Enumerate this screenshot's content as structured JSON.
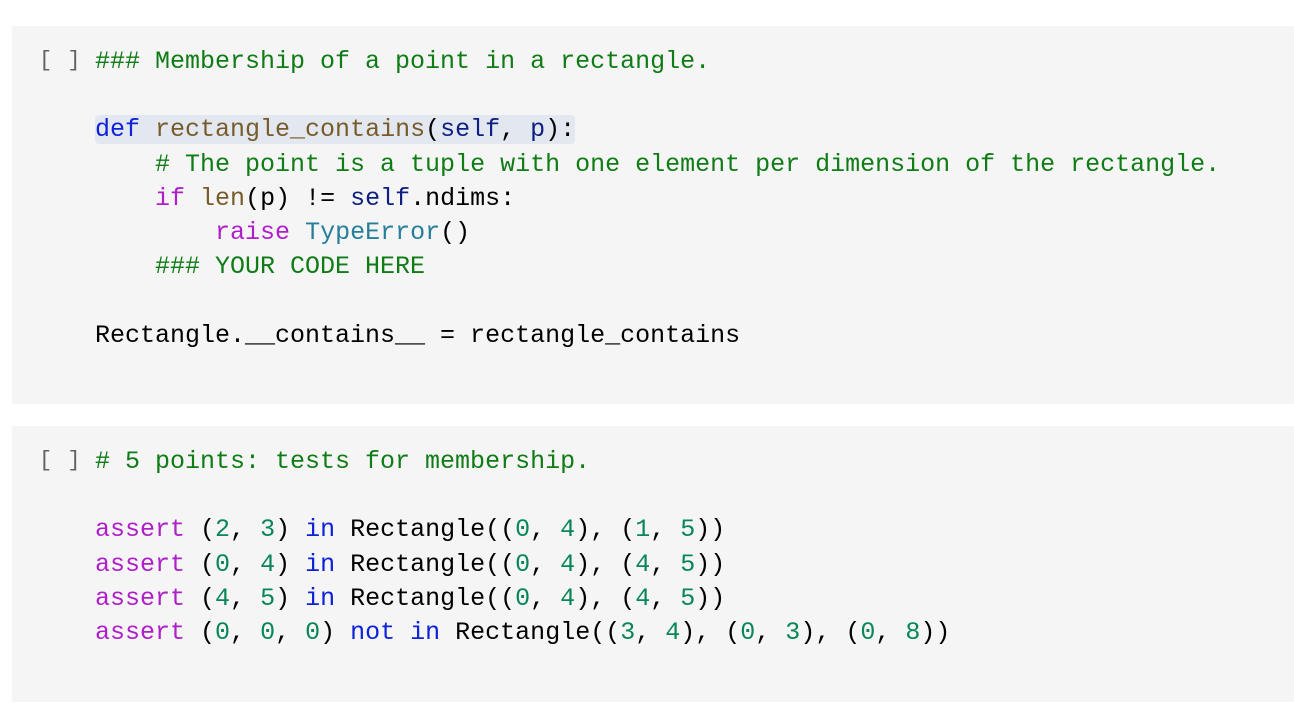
{
  "cells": [
    {
      "prompt": "[ ]",
      "lines": [
        [
          {
            "t": "### Membership of a point in a rectangle.",
            "c": "comment"
          }
        ],
        [],
        [
          {
            "t": "def",
            "c": "kw",
            "hl": true
          },
          {
            "t": " ",
            "c": "plain",
            "hl": true
          },
          {
            "t": "rectangle_contains",
            "c": "fn",
            "hl": true
          },
          {
            "t": "(",
            "c": "plain",
            "hl": true
          },
          {
            "t": "self",
            "c": "var",
            "hl": true
          },
          {
            "t": ", ",
            "c": "plain",
            "hl": true
          },
          {
            "t": "p",
            "c": "var",
            "hl": true
          },
          {
            "t": "):",
            "c": "plain",
            "hl": true
          }
        ],
        [
          {
            "t": "    ",
            "c": "plain"
          },
          {
            "t": "# The point is a tuple with one element per dimension of the rectangle.",
            "c": "comment"
          }
        ],
        [
          {
            "t": "    ",
            "c": "plain"
          },
          {
            "t": "if",
            "c": "ctrl"
          },
          {
            "t": " ",
            "c": "plain"
          },
          {
            "t": "len",
            "c": "fn"
          },
          {
            "t": "(p) != ",
            "c": "plain"
          },
          {
            "t": "self",
            "c": "var"
          },
          {
            "t": ".ndims:",
            "c": "plain"
          }
        ],
        [
          {
            "t": "        ",
            "c": "plain"
          },
          {
            "t": "raise",
            "c": "ctrl"
          },
          {
            "t": " ",
            "c": "plain"
          },
          {
            "t": "TypeError",
            "c": "cls"
          },
          {
            "t": "()",
            "c": "plain"
          }
        ],
        [
          {
            "t": "    ",
            "c": "plain"
          },
          {
            "t": "### YOUR CODE HERE",
            "c": "comment"
          }
        ],
        [],
        [
          {
            "t": "Rectangle.__contains__ = rectangle_contains",
            "c": "plain"
          }
        ]
      ]
    },
    {
      "prompt": "[ ]",
      "lines": [
        [
          {
            "t": "# 5 points: tests for membership.",
            "c": "comment"
          }
        ],
        [],
        [
          {
            "t": "assert",
            "c": "ctrl"
          },
          {
            "t": " (",
            "c": "plain"
          },
          {
            "t": "2",
            "c": "num"
          },
          {
            "t": ", ",
            "c": "plain"
          },
          {
            "t": "3",
            "c": "num"
          },
          {
            "t": ") ",
            "c": "plain"
          },
          {
            "t": "in",
            "c": "kw"
          },
          {
            "t": " Rectangle((",
            "c": "plain"
          },
          {
            "t": "0",
            "c": "num"
          },
          {
            "t": ", ",
            "c": "plain"
          },
          {
            "t": "4",
            "c": "num"
          },
          {
            "t": "), (",
            "c": "plain"
          },
          {
            "t": "1",
            "c": "num"
          },
          {
            "t": ", ",
            "c": "plain"
          },
          {
            "t": "5",
            "c": "num"
          },
          {
            "t": "))",
            "c": "plain"
          }
        ],
        [
          {
            "t": "assert",
            "c": "ctrl"
          },
          {
            "t": " (",
            "c": "plain"
          },
          {
            "t": "0",
            "c": "num"
          },
          {
            "t": ", ",
            "c": "plain"
          },
          {
            "t": "4",
            "c": "num"
          },
          {
            "t": ") ",
            "c": "plain"
          },
          {
            "t": "in",
            "c": "kw"
          },
          {
            "t": " Rectangle((",
            "c": "plain"
          },
          {
            "t": "0",
            "c": "num"
          },
          {
            "t": ", ",
            "c": "plain"
          },
          {
            "t": "4",
            "c": "num"
          },
          {
            "t": "), (",
            "c": "plain"
          },
          {
            "t": "4",
            "c": "num"
          },
          {
            "t": ", ",
            "c": "plain"
          },
          {
            "t": "5",
            "c": "num"
          },
          {
            "t": "))",
            "c": "plain"
          }
        ],
        [
          {
            "t": "assert",
            "c": "ctrl"
          },
          {
            "t": " (",
            "c": "plain"
          },
          {
            "t": "4",
            "c": "num"
          },
          {
            "t": ", ",
            "c": "plain"
          },
          {
            "t": "5",
            "c": "num"
          },
          {
            "t": ") ",
            "c": "plain"
          },
          {
            "t": "in",
            "c": "kw"
          },
          {
            "t": " Rectangle((",
            "c": "plain"
          },
          {
            "t": "0",
            "c": "num"
          },
          {
            "t": ", ",
            "c": "plain"
          },
          {
            "t": "4",
            "c": "num"
          },
          {
            "t": "), (",
            "c": "plain"
          },
          {
            "t": "4",
            "c": "num"
          },
          {
            "t": ", ",
            "c": "plain"
          },
          {
            "t": "5",
            "c": "num"
          },
          {
            "t": "))",
            "c": "plain"
          }
        ],
        [
          {
            "t": "assert",
            "c": "ctrl"
          },
          {
            "t": " (",
            "c": "plain"
          },
          {
            "t": "0",
            "c": "num"
          },
          {
            "t": ", ",
            "c": "plain"
          },
          {
            "t": "0",
            "c": "num"
          },
          {
            "t": ", ",
            "c": "plain"
          },
          {
            "t": "0",
            "c": "num"
          },
          {
            "t": ") ",
            "c": "plain"
          },
          {
            "t": "not",
            "c": "kw"
          },
          {
            "t": " ",
            "c": "plain"
          },
          {
            "t": "in",
            "c": "kw"
          },
          {
            "t": " Rectangle((",
            "c": "plain"
          },
          {
            "t": "3",
            "c": "num"
          },
          {
            "t": ", ",
            "c": "plain"
          },
          {
            "t": "4",
            "c": "num"
          },
          {
            "t": "), (",
            "c": "plain"
          },
          {
            "t": "0",
            "c": "num"
          },
          {
            "t": ", ",
            "c": "plain"
          },
          {
            "t": "3",
            "c": "num"
          },
          {
            "t": "), (",
            "c": "plain"
          },
          {
            "t": "0",
            "c": "num"
          },
          {
            "t": ", ",
            "c": "plain"
          },
          {
            "t": "8",
            "c": "num"
          },
          {
            "t": "))",
            "c": "plain"
          }
        ]
      ]
    }
  ]
}
